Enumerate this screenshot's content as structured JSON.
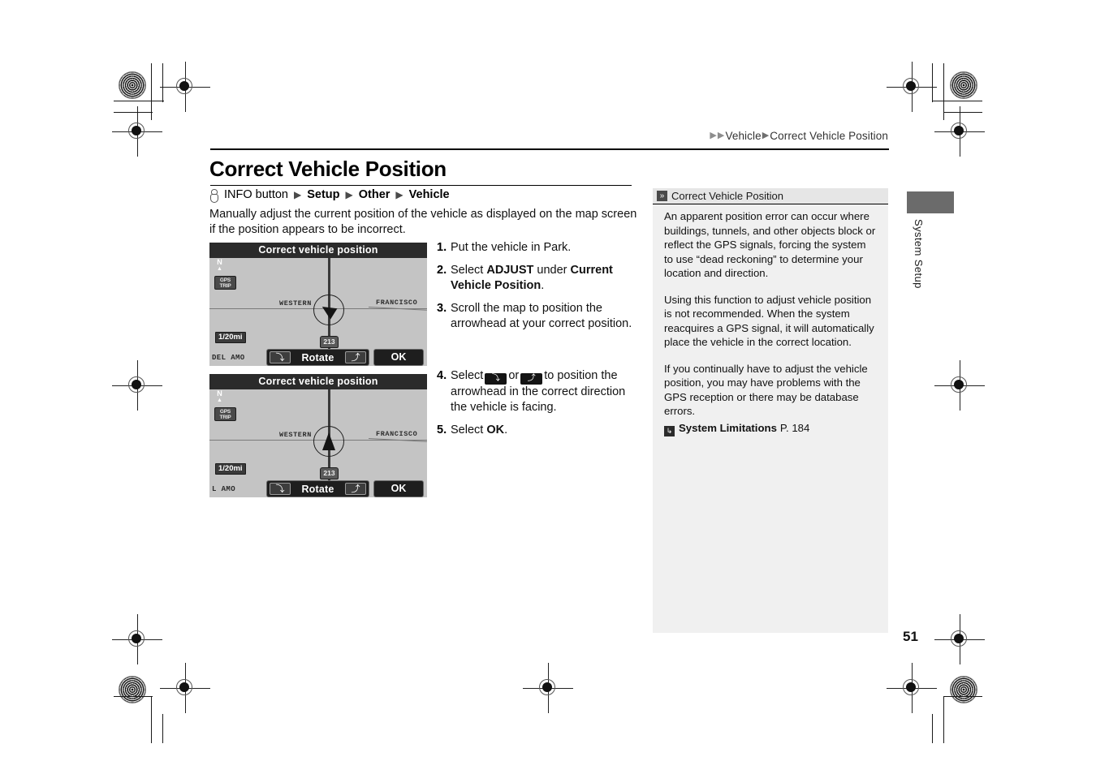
{
  "header": {
    "breadcrumb": {
      "arrow1": "▶",
      "arrow2": "▶",
      "section": "Vehicle",
      "arrow3": "▶",
      "page": "Correct Vehicle Position"
    }
  },
  "title": "Correct Vehicle Position",
  "nav_path": {
    "info_icon": "info-button-icon",
    "button_label": "INFO button",
    "triangle": "▶",
    "items": [
      "Setup",
      "Other",
      "Vehicle"
    ]
  },
  "intro": "Manually adjust the current position of the vehicle as displayed on the map screen if the position appears to be incorrect.",
  "screens": [
    {
      "titlebar": "Correct vehicle position",
      "north_label": "N",
      "north_arrow": "▲",
      "gps_badge_line1": "GPS",
      "gps_badge_line2": "TRIP",
      "scale": "1/20mi",
      "corner_street": "DEL AMO",
      "street_west": "WESTERN",
      "street_east": "FRANCISCO",
      "route_shield": "213",
      "rotate_left": "⤵",
      "rotate_label": "Rotate",
      "rotate_right": "⤴",
      "ok_label": "OK"
    },
    {
      "titlebar": "Correct vehicle position",
      "north_label": "N",
      "north_arrow": "▲",
      "gps_badge_line1": "GPS",
      "gps_badge_line2": "TRIP",
      "scale": "1/20mi",
      "corner_street": "L AMO",
      "street_west": "WESTERN",
      "street_east": "FRANCISCO",
      "route_shield": "213",
      "rotate_left": "⤵",
      "rotate_label": "Rotate",
      "rotate_right": "⤴",
      "ok_label": "OK"
    }
  ],
  "steps_group_a": [
    {
      "num": "1.",
      "text": "Put the vehicle in Park."
    },
    {
      "num": "2.",
      "text": "Select ADJUST under Current Vehicle Position."
    },
    {
      "num": "3.",
      "text": "Scroll the map to position the arrowhead at your correct position."
    }
  ],
  "steps_group_b": [
    {
      "num": "4.",
      "text": "Select   or   to position the arrowhead in the correct direction the vehicle is facing.",
      "btn_left": "⤵",
      "btn_right": "⤴"
    },
    {
      "num": "5.",
      "text": "Select OK."
    }
  ],
  "sidebar": {
    "chevron_icon": "»",
    "heading": "Correct Vehicle Position",
    "paragraphs": [
      "An apparent position error can occur where buildings, tunnels, and other objects block or reflect the GPS signals, forcing the system to use “dead reckoning” to determine your location and direction.",
      "Using this function to adjust vehicle position is not recommended. When the system reacquires a GPS signal, it will automatically place the vehicle in the correct location.",
      "If you continually have to adjust the vehicle position, you may have problems with the GPS reception or there may be database errors."
    ],
    "xref": {
      "icon": "↳",
      "title": "System Limitations",
      "page": "P. 184"
    }
  },
  "side_tab": {
    "label": "System Setup"
  },
  "page_number": "51",
  "colors": {
    "sidebar_bg": "#f0f0f0",
    "sidebar_head_bg": "#e6e6e6",
    "side_tab_block": "#6b6b6b",
    "nav_titlebar": "#2b2b2b",
    "nav_map_bg": "#c4c4c4"
  }
}
